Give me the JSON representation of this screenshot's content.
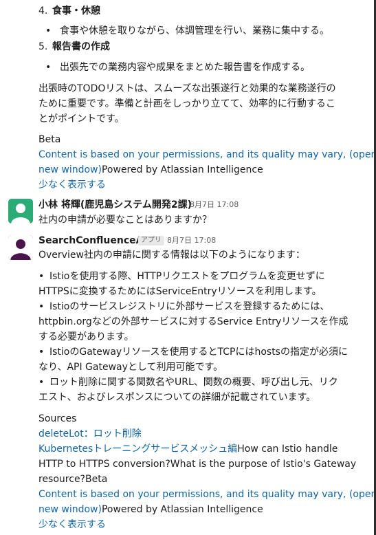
{
  "first_message": {
    "item4": {
      "num": "4.",
      "title": "食事・休憩",
      "bullet": "食事や休憩を取りながら、体調管理を行い、業務に集中する。"
    },
    "item5": {
      "num": "5.",
      "title": "報告書の作成",
      "bullet": "出張先での業務内容や成果をまとめた報告書を作成する。"
    },
    "summary": [
      "出張時のTODOリストは、スムーズな出張遂行と効果的な業務遂行の",
      "ために重要です。準備と計画をしっかり立てて、効率的に行動するこ",
      "とがポイントです。"
    ],
    "beta": "Beta",
    "disclaimer_link_1": "Content is based on your permissions, and its quality may vary, (opens",
    "disclaimer_link_2": "new window)",
    "powered_by": "Powered by Atlassian Intelligence",
    "show_less": "少なく表示する"
  },
  "question_message": {
    "sender": "小林 将輝(鹿児島システム開発2課)",
    "timestamp": "8月7日 17:08",
    "text": "社内の申請が必要なことはありますか？",
    "avatar_color": "#2bac76"
  },
  "answer_message": {
    "sender": "SearchConfluenceApp",
    "app_tag": "アプリ",
    "timestamp": "8月7日 17:08",
    "avatar_color": "#4a154b",
    "overview": "Overview社内の申請に関する情報は以下のようになります：",
    "bullets": [
      {
        "lines": [
          "Istioを使用する際、HTTPリクエストをプログラムを変更せずに",
          "HTTPSに変換するためにはServiceEntryリソースを利用します。"
        ]
      },
      {
        "lines": [
          "Istioのサービスレジストリに外部サービスを登録するためには、",
          "httpbin.orgなどの外部サービスに対するService Entryリソースを作成",
          "する必要があります。"
        ]
      },
      {
        "lines": [
          "IstioのGatewayリソースを使用するとTCPにはhostsの指定が必須に",
          "なり、API Gatewayとして利用可能です。"
        ]
      },
      {
        "lines": [
          "ロット削除に関する関数名やURL、関数の概要、呼び出し元、リク",
          "エスト、およびレスポンスについての詳細が記載されています。"
        ]
      }
    ],
    "sources_label": "Sources",
    "source_1": "deleteLot：ロット削除",
    "source_2": "Kubernetesトレーニングサービスメッシュ編",
    "source_2_suffix": "How can Istio handle",
    "tail_line_1": "HTTP to HTTPS conversion?What is the purpose of Istio's Gateway",
    "tail_line_2": "resource?Beta",
    "disclaimer_link_1": "Content is based on your permissions, and its quality may vary, (opens",
    "disclaimer_link_2": "new window)",
    "powered_by": "Powered by Atlassian Intelligence",
    "show_less": "少なく表示する"
  }
}
